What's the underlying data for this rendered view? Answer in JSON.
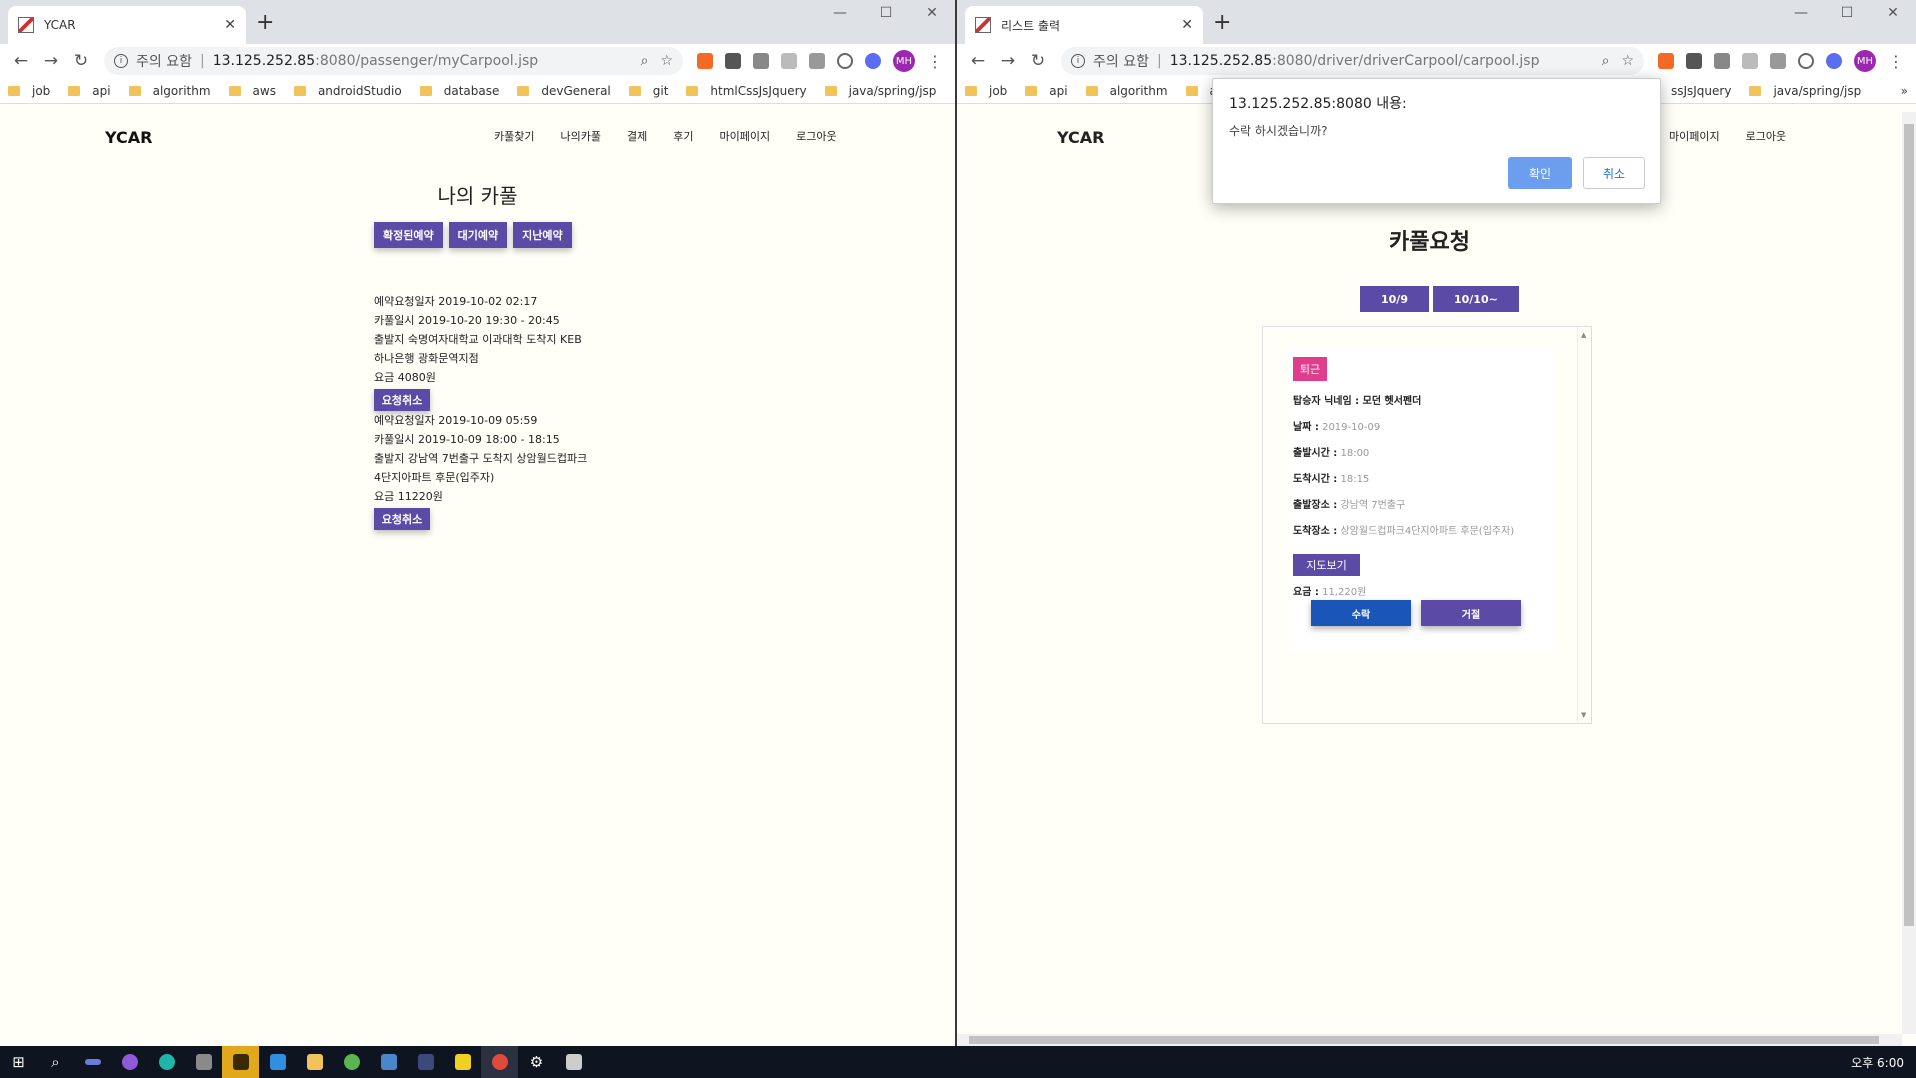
{
  "left_window": {
    "tab_title": "YCAR",
    "url_warning": "주의 요함",
    "url_host": "13.125.252.85",
    "url_path": ":8080/passenger/myCarpool.jsp",
    "bookmarks": [
      "job",
      "api",
      "algorithm",
      "aws",
      "androidStudio",
      "database",
      "devGeneral",
      "git",
      "htmlCssJsJquery",
      "java/spring/jsp"
    ],
    "more": "»",
    "logo": "YCAR",
    "menu": [
      "카풀찾기",
      "나의카풀",
      "결제",
      "후기",
      "마이페이지",
      "로그아웃"
    ],
    "heading": "나의 카풀",
    "tabs": [
      "확정된예약",
      "대기예약",
      "지난예약"
    ],
    "bookings": [
      {
        "request_date": "예약요청일자 2019-10-02 02:17",
        "carpool_date": "카풀일시 2019-10-20 19:30 - 20:45",
        "route_line1": "출발지 숙명여자대학교 이과대학 도착지 KEB",
        "route_line2": "하나은행 광화문역지점",
        "fare": "요금 4080원",
        "cancel_label": "요청취소"
      },
      {
        "request_date": "예약요청일자 2019-10-09 05:59",
        "carpool_date": "카풀일시 2019-10-09 18:00 - 18:15",
        "route_line1": "출발지 강남역 7번출구 도착지 상암월드컵파크",
        "route_line2": "4단지아파트 후문(입주자)",
        "fare": "요금 11220원",
        "cancel_label": "요청취소"
      }
    ]
  },
  "right_window": {
    "tab_title": "리스트 출력",
    "url_warning": "주의 요함",
    "url_host": "13.125.252.85",
    "url_path": ":8080/driver/driverCarpool/carpool.jsp",
    "bookmarks": [
      "job",
      "api",
      "algorithm",
      "aws"
    ],
    "bookmarks_right": [
      "ssJsJquery",
      "java/spring/jsp"
    ],
    "more": "»",
    "logo": "YCAR",
    "menu": [
      "마이페이지",
      "로그아웃"
    ],
    "heading": "카풀요청",
    "date_tabs": [
      "10/9",
      "10/10~"
    ],
    "card": {
      "badge": "퇴근",
      "nickname": "탑승자 닉네임 : 모던 헷서펜더",
      "date_label": "날짜 :",
      "date_value": "2019-10-09",
      "depart_time_label": "출발시간 :",
      "depart_time_value": "18:00",
      "arrive_time_label": "도착시간 :",
      "arrive_time_value": "18:15",
      "depart_place_label": "출발장소 :",
      "depart_place_value": "강남역 7번출구",
      "arrive_place_label": "도착장소 :",
      "arrive_place_value": "상암월드컵파크4단지아파트 후문(입주자)",
      "map_button": "지도보기",
      "fare_label": "요금 :",
      "fare_value": "11,220원",
      "accept": "수락",
      "reject": "거절"
    },
    "dialog": {
      "title": "13.125.252.85:8080 내용:",
      "message": "수락 하시겠습니까?",
      "ok": "확인",
      "cancel": "취소"
    }
  },
  "taskbar": {
    "clock": "오후 6:00"
  },
  "colors": {
    "button_purple": "#5b4ba6",
    "accept_blue": "#1a56b8",
    "badge_pink": "#e03e8c",
    "page_bg": "#fffef7"
  }
}
